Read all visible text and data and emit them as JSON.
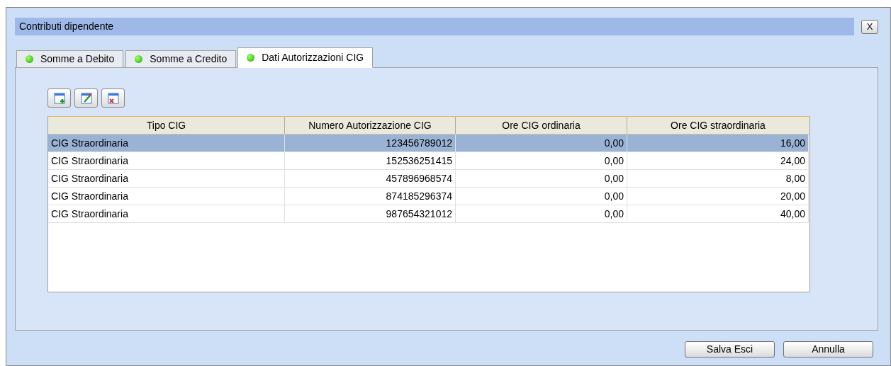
{
  "window": {
    "title": "Contributi dipendente",
    "close": "X"
  },
  "tabs": [
    {
      "label": "Somme a Debito",
      "selected": false
    },
    {
      "label": "Somme a Credito",
      "selected": false
    },
    {
      "label": "Dati Autorizzazioni CIG",
      "selected": true
    }
  ],
  "toolbar": [
    {
      "kind": "add"
    },
    {
      "kind": "edit"
    },
    {
      "kind": "delete"
    }
  ],
  "table": {
    "columns": [
      "Tipo CIG",
      "Numero Autorizzazione CIG",
      "Ore CIG ordinaria",
      "Ore CIG straordinaria"
    ],
    "rows": [
      {
        "cells": [
          "CIG Straordinaria",
          "123456789012",
          "0,00",
          "16,00"
        ],
        "selected": true
      },
      {
        "cells": [
          "CIG Straordinaria",
          "152536251415",
          "0,00",
          "24,00"
        ],
        "selected": false
      },
      {
        "cells": [
          "CIG Straordinaria",
          "457896968574",
          "0,00",
          "8,00"
        ],
        "selected": false
      },
      {
        "cells": [
          "CIG Straordinaria",
          "874185296374",
          "0,00",
          "20,00"
        ],
        "selected": false
      },
      {
        "cells": [
          "CIG Straordinaria",
          "987654321012",
          "0,00",
          "40,00"
        ],
        "selected": false
      }
    ]
  },
  "buttons": [
    "Salva Esci",
    "Annulla"
  ]
}
